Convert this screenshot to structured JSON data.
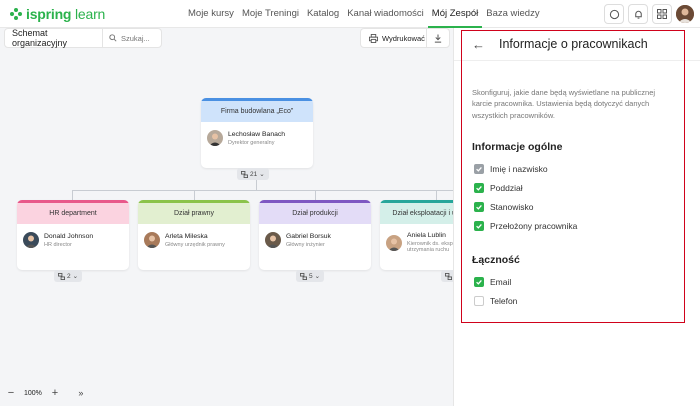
{
  "logo": {
    "brand": "ispring",
    "product": "learn"
  },
  "nav": [
    {
      "label": "Moje kursy",
      "active": false
    },
    {
      "label": "Moje Treningi",
      "active": false
    },
    {
      "label": "Katalog",
      "active": false
    },
    {
      "label": "Kanał wiadomości",
      "active": false
    },
    {
      "label": "Mój Zespół",
      "active": true
    },
    {
      "label": "Baza wiedzy",
      "active": false
    }
  ],
  "canvas": {
    "schema_title": "Schemat organizacyjny",
    "search_placeholder": "Szukaj...",
    "print_label": "Wydrukować",
    "zoom_level": "100%"
  },
  "org": {
    "root": {
      "title": "Firma budowlana „Eco”",
      "name": "Lechosław Banach",
      "role": "Dyrektor generalny",
      "count": "21",
      "color": "#cfe3fb",
      "border": "#4a90e2"
    },
    "departments": [
      {
        "title": "HR department",
        "name": "Donald Johnson",
        "role": "HR director",
        "count": "2",
        "color": "#fbd3e0",
        "border": "#e8588a"
      },
      {
        "title": "Dział prawny",
        "name": "Arleta Mileska",
        "role": "Główny urzędnik prawny",
        "count": "",
        "color": "#e2efd0",
        "border": "#8bc34a"
      },
      {
        "title": "Dział produkcji",
        "name": "Gabriel Borsuk",
        "role": "Główny inżynier",
        "count": "5",
        "color": "#e3dcf7",
        "border": "#7e57c2"
      },
      {
        "title": "Dział eksploatacji i utr ruchu",
        "name": "Aniela Lublin",
        "role": "Kierownik ds. eksploat utrzymania ruchu",
        "count": "",
        "color": "#d4efe9",
        "border": "#26a69a"
      }
    ]
  },
  "panel": {
    "title": "Informacje o pracownikach",
    "description": "Skonfiguruj, jakie dane będą wyświetlane na publicznej karcie pracownika. Ustawienia będą dotyczyć danych wszystkich pracowników.",
    "general_title": "Informacje ogólne",
    "general": [
      {
        "label": "Imię i nazwisko",
        "state": "grey"
      },
      {
        "label": "Poddział",
        "state": "on"
      },
      {
        "label": "Stanowisko",
        "state": "on"
      },
      {
        "label": "Przełożony pracownika",
        "state": "on"
      }
    ],
    "contact_title": "Łączność",
    "contact": [
      {
        "label": "Email",
        "state": "on"
      },
      {
        "label": "Telefon",
        "state": "off"
      }
    ]
  },
  "colors": {
    "accent": "#2bb24c",
    "highlight": "#d0021b"
  }
}
